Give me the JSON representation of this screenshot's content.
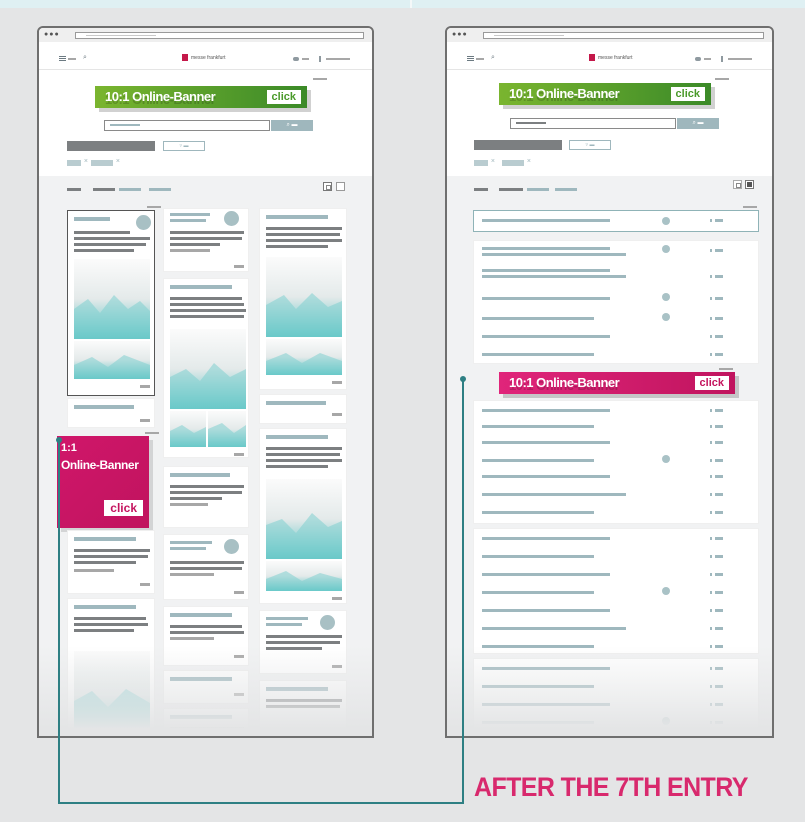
{
  "caption": "AFTER THE 7TH ENTRY",
  "left_layout": {
    "logo_text": "messe frankfurt",
    "top_banner": {
      "label": "10:1 Online-Banner",
      "click": "click"
    },
    "square_banner": {
      "line1": "1:1",
      "line2": "Online-Banner",
      "click": "click"
    }
  },
  "right_layout": {
    "logo_text": "messe frankfurt",
    "top_banner": {
      "label": "10:1 Online-Banner",
      "click": "click"
    },
    "inline_banner": {
      "label": "10:1 Online-Banner",
      "click": "click"
    }
  },
  "colors": {
    "green_banner": "#5aa72c",
    "magenta_banner": "#cc1c6e",
    "accent_text": "#d8296d",
    "connector": "#2e7f83",
    "teal_image": "#4fc1c1"
  },
  "icons": [
    "hamburger-icon",
    "search-icon",
    "logo-mark-icon",
    "list-view-icon",
    "grid-view-icon",
    "close-icon"
  ]
}
